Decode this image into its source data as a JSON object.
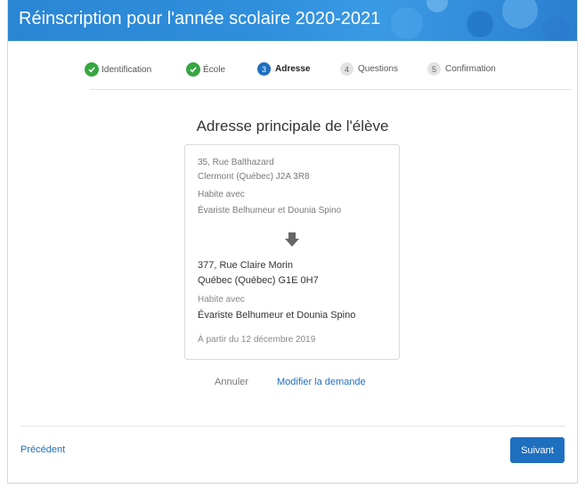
{
  "banner": {
    "title": "Réinscription pour l'année scolaire 2020-2021"
  },
  "steps": [
    {
      "label": "Identification",
      "state": "done"
    },
    {
      "label": "École",
      "state": "done"
    },
    {
      "number": "3",
      "label": "Adresse",
      "state": "active"
    },
    {
      "number": "4",
      "label": "Questions",
      "state": "pending"
    },
    {
      "number": "5",
      "label": "Confirmation",
      "state": "pending"
    }
  ],
  "main": {
    "heading": "Adresse principale de l'élève",
    "old_address": {
      "street": "35, Rue Balthazard",
      "city": "Clermont (Québec) J2A 3R8",
      "lives_with_label": "Habite avec",
      "lives_with": "Évariste Belhumeur et Dounia Spino"
    },
    "new_address": {
      "street": "377, Rue Claire Morin",
      "city": "Québec (Québec) G1E 0H7",
      "lives_with_label": "Habite avec",
      "lives_with": "Évariste Belhumeur et Dounia Spino",
      "effective": "À partir du 12 décembre 2019"
    },
    "cancel_label": "Annuler",
    "modify_label": "Modifier la demande"
  },
  "footer": {
    "previous_label": "Précédent",
    "next_label": "Suivant"
  },
  "colors": {
    "primary": "#1f6fbf",
    "success": "#37a641",
    "banner": "#2f8fdc"
  }
}
